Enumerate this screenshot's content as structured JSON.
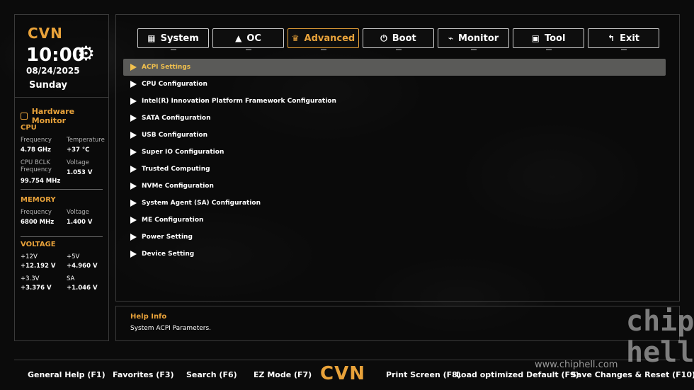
{
  "left": {
    "logo": "CVN",
    "time": "10:00",
    "date": "08/24/2025",
    "weekday": "Sunday",
    "hardware_monitor_title": "Hardware Monitor",
    "cpu": {
      "title": "CPU",
      "frequency_label": "Frequency",
      "frequency_value": "4.78 GHz",
      "temperature_label": "Temperature",
      "temperature_value": "+37 °C",
      "bclk_label_line1": "CPU BCLK",
      "bclk_label_line2": "Frequency",
      "bclk_value": "99.754 MHz",
      "voltage_label": "Voltage",
      "voltage_value": "1.053 V"
    },
    "memory": {
      "title": "MEMORY",
      "frequency_label": "Frequency",
      "frequency_value": "6800 MHz",
      "voltage_label": "Voltage",
      "voltage_value": "1.400 V"
    },
    "voltage": {
      "title": "VOLTAGE",
      "v12_label": "+12V",
      "v12_value": "+12.192 V",
      "v5_label": "+5V",
      "v5_value": "+4.960 V",
      "v33_label": "+3.3V",
      "v33_value": "+3.376 V",
      "sa_label": "SA",
      "sa_value": "+1.046 V"
    }
  },
  "tabs": [
    {
      "label": "System",
      "icon": "grid-icon"
    },
    {
      "label": "OC",
      "icon": "rocket-icon"
    },
    {
      "label": "Advanced",
      "icon": "crown-icon"
    },
    {
      "label": "Boot",
      "icon": "power-icon"
    },
    {
      "label": "Monitor",
      "icon": "pulse-icon"
    },
    {
      "label": "Tool",
      "icon": "toolbox-icon"
    },
    {
      "label": "Exit",
      "icon": "return-arrow-icon"
    }
  ],
  "active_tab": "Advanced",
  "menu": [
    "ACPI Settings",
    "CPU Configuration",
    "Intel(R) Innovation Platform Framework Configuration",
    "SATA Configuration",
    "USB Configuration",
    "Super IO Configuration",
    "Trusted Computing",
    "NVMe Configuration",
    "System Agent (SA) Configuration",
    "ME Configuration",
    "Power Setting",
    "Device Setting"
  ],
  "selected_menu": "ACPI Settings",
  "help": {
    "title": "Help Info",
    "text": "System ACPI Parameters."
  },
  "footer": {
    "general_help": "General Help (F1)",
    "favorites": "Favorites (F3)",
    "search": "Search (F6)",
    "ez_mode": "EZ Mode (F7)",
    "logo": "CVN",
    "print_screen": "Print Screen (F8)",
    "load_defaults": "Load optimized Default (F9)",
    "save_reset": "Save Changes & Reset (F10)"
  },
  "watermark": {
    "url": "www.chiphell.com",
    "logo_line1": "chip",
    "logo_line2": "hell"
  },
  "colors": {
    "accent": "#e8a23a",
    "selected_text": "#f2c14e",
    "selected_bg": "#5a5a58",
    "background": "#0b0b0b"
  }
}
